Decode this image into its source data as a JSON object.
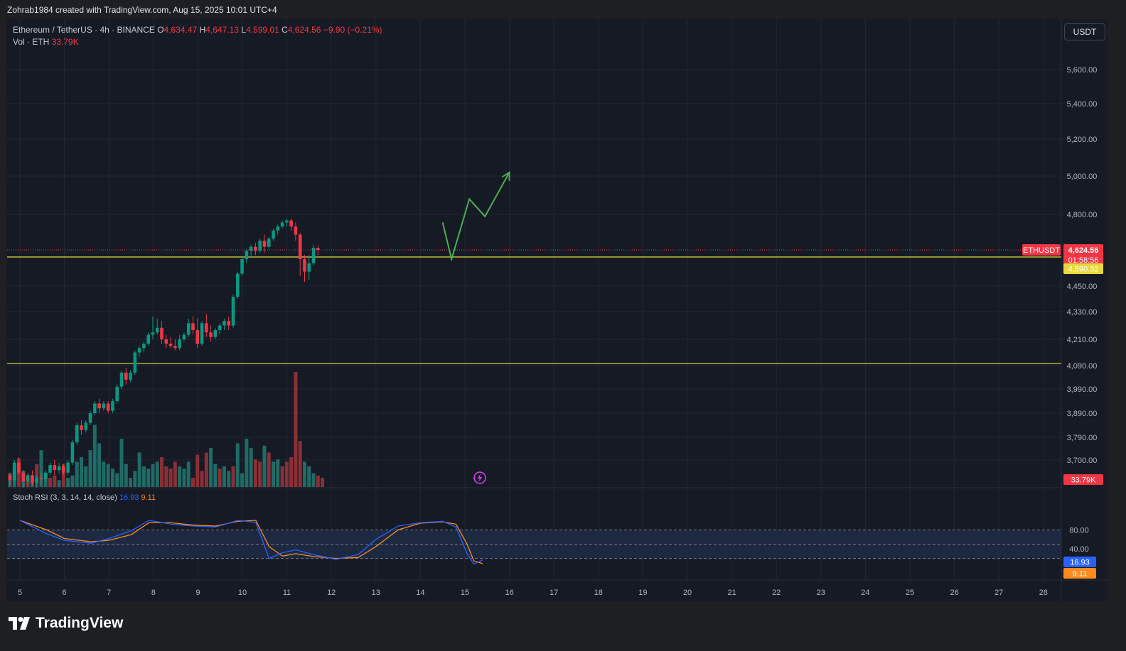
{
  "header": {
    "creator": "Zohrab1984 created with TradingView.com, Aug 15, 2025 10:01 UTC+4"
  },
  "legend": {
    "symbol": "Ethereum / TetherUS · 4h · BINANCE",
    "o_label": "O",
    "o_value": "4,634.47",
    "h_label": "H",
    "h_value": "4,647.13",
    "l_label": "L",
    "l_value": "4,599.01",
    "c_label": "C",
    "c_value": "4,624.56",
    "change": "−9.90 (−0.21%)",
    "vol_label": "Vol · ETH",
    "vol_value": "33.79K"
  },
  "currency_button": "USDT",
  "price_tags": {
    "symbol_tag": "ETHUSDT",
    "last_price": "4,624.56",
    "countdown": "01:58:56",
    "level_price": "4,590.32",
    "volume_tag": "33.79K"
  },
  "rsi": {
    "title": "Stoch RSI (3, 3, 14, 14, close)",
    "k_value": "16.93",
    "d_value": "9.11"
  },
  "brand": "TradingView",
  "colors": {
    "up": "#089981",
    "down": "#f23645",
    "volume_up": "#1f6b66",
    "volume_down": "#8b2f36",
    "level_line": "#e8d93a",
    "projection": "#4caf50",
    "k_line": "#2962ff",
    "d_line": "#ff8a1f"
  },
  "chart_data": {
    "type": "candlestick",
    "y_ticks": [
      "5,600.00",
      "5,400.00",
      "5,200.00",
      "5,000.00",
      "4,800.00",
      "4,450.00",
      "4,330.00",
      "4,210.00",
      "4,090.00",
      "3,990.00",
      "3,890.00",
      "3,790.00",
      "3,700.00"
    ],
    "x_ticks": [
      "5",
      "6",
      "7",
      "8",
      "9",
      "10",
      "11",
      "12",
      "13",
      "14",
      "15",
      "16",
      "17",
      "18",
      "19",
      "20",
      "21",
      "22",
      "23",
      "24",
      "25",
      "26",
      "27",
      "28"
    ],
    "horizontal_levels": [
      4590.32,
      4100
    ],
    "projection_path": [
      [
        14.5,
        4760
      ],
      [
        14.7,
        4580
      ],
      [
        15.1,
        4880
      ],
      [
        15.45,
        4790
      ],
      [
        16.0,
        5020
      ]
    ],
    "candles": [
      [
        3640,
        3650,
        3600,
        3620
      ],
      [
        3620,
        3700,
        3610,
        3690
      ],
      [
        3690,
        3710,
        3640,
        3650
      ],
      [
        3650,
        3660,
        3590,
        3615
      ],
      [
        3615,
        3650,
        3600,
        3640
      ],
      [
        3640,
        3660,
        3600,
        3610
      ],
      [
        3610,
        3640,
        3590,
        3630
      ],
      [
        3630,
        3650,
        3600,
        3625
      ],
      [
        3625,
        3660,
        3610,
        3650
      ],
      [
        3650,
        3690,
        3640,
        3680
      ],
      [
        3680,
        3700,
        3640,
        3660
      ],
      [
        3660,
        3690,
        3645,
        3675
      ],
      [
        3675,
        3685,
        3640,
        3650
      ],
      [
        3650,
        3700,
        3640,
        3690
      ],
      [
        3690,
        3780,
        3680,
        3770
      ],
      [
        3770,
        3850,
        3760,
        3840
      ],
      [
        3840,
        3860,
        3800,
        3820
      ],
      [
        3820,
        3860,
        3810,
        3850
      ],
      [
        3850,
        3900,
        3840,
        3890
      ],
      [
        3890,
        3940,
        3880,
        3930
      ],
      [
        3930,
        3950,
        3890,
        3910
      ],
      [
        3910,
        3940,
        3900,
        3930
      ],
      [
        3930,
        3940,
        3890,
        3900
      ],
      [
        3900,
        3950,
        3890,
        3940
      ],
      [
        3940,
        4010,
        3930,
        4000
      ],
      [
        4000,
        4070,
        3990,
        4060
      ],
      [
        4060,
        4080,
        4010,
        4030
      ],
      [
        4030,
        4070,
        4020,
        4060
      ],
      [
        4060,
        4160,
        4050,
        4150
      ],
      [
        4150,
        4180,
        4130,
        4170
      ],
      [
        4170,
        4200,
        4150,
        4190
      ],
      [
        4190,
        4240,
        4180,
        4230
      ],
      [
        4230,
        4310,
        4210,
        4240
      ],
      [
        4240,
        4300,
        4230,
        4260
      ],
      [
        4260,
        4290,
        4190,
        4210
      ],
      [
        4210,
        4230,
        4170,
        4190
      ],
      [
        4190,
        4220,
        4170,
        4180
      ],
      [
        4180,
        4210,
        4160,
        4170
      ],
      [
        4170,
        4230,
        4160,
        4210
      ],
      [
        4210,
        4240,
        4200,
        4230
      ],
      [
        4230,
        4300,
        4220,
        4280
      ],
      [
        4280,
        4310,
        4230,
        4250
      ],
      [
        4250,
        4300,
        4170,
        4190
      ],
      [
        4190,
        4290,
        4180,
        4280
      ],
      [
        4280,
        4320,
        4220,
        4240
      ],
      [
        4240,
        4270,
        4200,
        4220
      ],
      [
        4220,
        4260,
        4210,
        4250
      ],
      [
        4250,
        4280,
        4230,
        4270
      ],
      [
        4270,
        4300,
        4250,
        4290
      ],
      [
        4290,
        4310,
        4250,
        4270
      ],
      [
        4270,
        4410,
        4260,
        4400
      ],
      [
        4400,
        4520,
        4390,
        4510
      ],
      [
        4510,
        4590,
        4500,
        4580
      ],
      [
        4580,
        4630,
        4560,
        4620
      ],
      [
        4620,
        4650,
        4590,
        4640
      ],
      [
        4640,
        4660,
        4600,
        4620
      ],
      [
        4620,
        4680,
        4610,
        4670
      ],
      [
        4670,
        4700,
        4610,
        4640
      ],
      [
        4640,
        4690,
        4630,
        4680
      ],
      [
        4680,
        4730,
        4670,
        4720
      ],
      [
        4720,
        4750,
        4700,
        4740
      ],
      [
        4740,
        4770,
        4730,
        4760
      ],
      [
        4760,
        4780,
        4740,
        4770
      ],
      [
        4770,
        4780,
        4720,
        4740
      ],
      [
        4740,
        4760,
        4670,
        4700
      ],
      [
        4700,
        4710,
        4500,
        4580
      ],
      [
        4580,
        4600,
        4470,
        4520
      ],
      [
        4520,
        4600,
        4480,
        4560
      ],
      [
        4560,
        4650,
        4550,
        4635
      ],
      [
        4634.47,
        4647.13,
        4599.01,
        4624.56
      ]
    ],
    "volumes": [
      [
        12,
        1
      ],
      [
        18,
        1
      ],
      [
        25,
        0
      ],
      [
        14,
        1
      ],
      [
        8,
        0
      ],
      [
        10,
        1
      ],
      [
        20,
        0
      ],
      [
        32,
        1
      ],
      [
        12,
        1
      ],
      [
        8,
        0
      ],
      [
        10,
        0
      ],
      [
        6,
        1
      ],
      [
        20,
        0
      ],
      [
        8,
        1
      ],
      [
        10,
        1
      ],
      [
        22,
        1
      ],
      [
        26,
        1
      ],
      [
        18,
        1
      ],
      [
        32,
        1
      ],
      [
        54,
        1
      ],
      [
        38,
        1
      ],
      [
        22,
        1
      ],
      [
        20,
        1
      ],
      [
        16,
        1
      ],
      [
        12,
        1
      ],
      [
        42,
        1
      ],
      [
        20,
        1
      ],
      [
        8,
        1
      ],
      [
        14,
        1
      ],
      [
        30,
        1
      ],
      [
        18,
        1
      ],
      [
        16,
        1
      ],
      [
        20,
        1
      ],
      [
        22,
        1
      ],
      [
        26,
        0
      ],
      [
        18,
        0
      ],
      [
        16,
        0
      ],
      [
        22,
        0
      ],
      [
        18,
        1
      ],
      [
        16,
        1
      ],
      [
        22,
        1
      ],
      [
        8,
        0
      ],
      [
        28,
        0
      ],
      [
        14,
        0
      ],
      [
        30,
        0
      ],
      [
        34,
        1
      ],
      [
        20,
        1
      ],
      [
        16,
        0
      ],
      [
        18,
        1
      ],
      [
        14,
        1
      ],
      [
        18,
        0
      ],
      [
        38,
        1
      ],
      [
        12,
        1
      ],
      [
        42,
        1
      ],
      [
        34,
        1
      ],
      [
        24,
        0
      ],
      [
        22,
        0
      ],
      [
        36,
        1
      ],
      [
        30,
        0
      ],
      [
        22,
        1
      ],
      [
        24,
        1
      ],
      [
        18,
        0
      ],
      [
        22,
        0
      ],
      [
        26,
        0
      ],
      [
        100,
        0
      ],
      [
        40,
        0
      ],
      [
        22,
        1
      ],
      [
        18,
        1
      ],
      [
        12,
        1
      ],
      [
        10,
        0
      ],
      [
        8,
        0
      ]
    ],
    "stoch_rsi": {
      "levels": [
        80,
        50,
        20
      ],
      "y_ticks": [
        "80.00",
        "40.00"
      ],
      "k": [
        [
          0,
          100
        ],
        [
          0.6,
          72
        ],
        [
          1.0,
          58
        ],
        [
          1.6,
          52
        ],
        [
          2.0,
          62
        ],
        [
          2.5,
          78
        ],
        [
          2.9,
          100
        ],
        [
          3.4,
          92
        ],
        [
          3.9,
          88
        ],
        [
          4.4,
          86
        ],
        [
          4.9,
          100
        ],
        [
          5.3,
          96
        ],
        [
          5.6,
          20
        ],
        [
          5.9,
          32
        ],
        [
          6.2,
          38
        ],
        [
          6.6,
          28
        ],
        [
          7.1,
          18
        ],
        [
          7.6,
          28
        ],
        [
          8.0,
          60
        ],
        [
          8.5,
          88
        ],
        [
          9.0,
          95
        ],
        [
          9.5,
          98
        ],
        [
          9.8,
          86
        ],
        [
          10.05,
          30
        ],
        [
          10.2,
          8
        ],
        [
          10.4,
          16.93
        ]
      ],
      "d": [
        [
          0,
          100
        ],
        [
          0.6,
          80
        ],
        [
          1.0,
          62
        ],
        [
          1.6,
          55
        ],
        [
          2.0,
          58
        ],
        [
          2.5,
          70
        ],
        [
          2.9,
          95
        ],
        [
          3.4,
          95
        ],
        [
          3.9,
          90
        ],
        [
          4.4,
          88
        ],
        [
          4.9,
          98
        ],
        [
          5.3,
          100
        ],
        [
          5.6,
          45
        ],
        [
          5.9,
          25
        ],
        [
          6.2,
          30
        ],
        [
          6.6,
          24
        ],
        [
          7.1,
          20
        ],
        [
          7.6,
          22
        ],
        [
          8.0,
          45
        ],
        [
          8.5,
          80
        ],
        [
          9.0,
          94
        ],
        [
          9.5,
          97
        ],
        [
          9.8,
          92
        ],
        [
          10.05,
          50
        ],
        [
          10.2,
          15
        ],
        [
          10.4,
          9.11
        ]
      ]
    }
  }
}
